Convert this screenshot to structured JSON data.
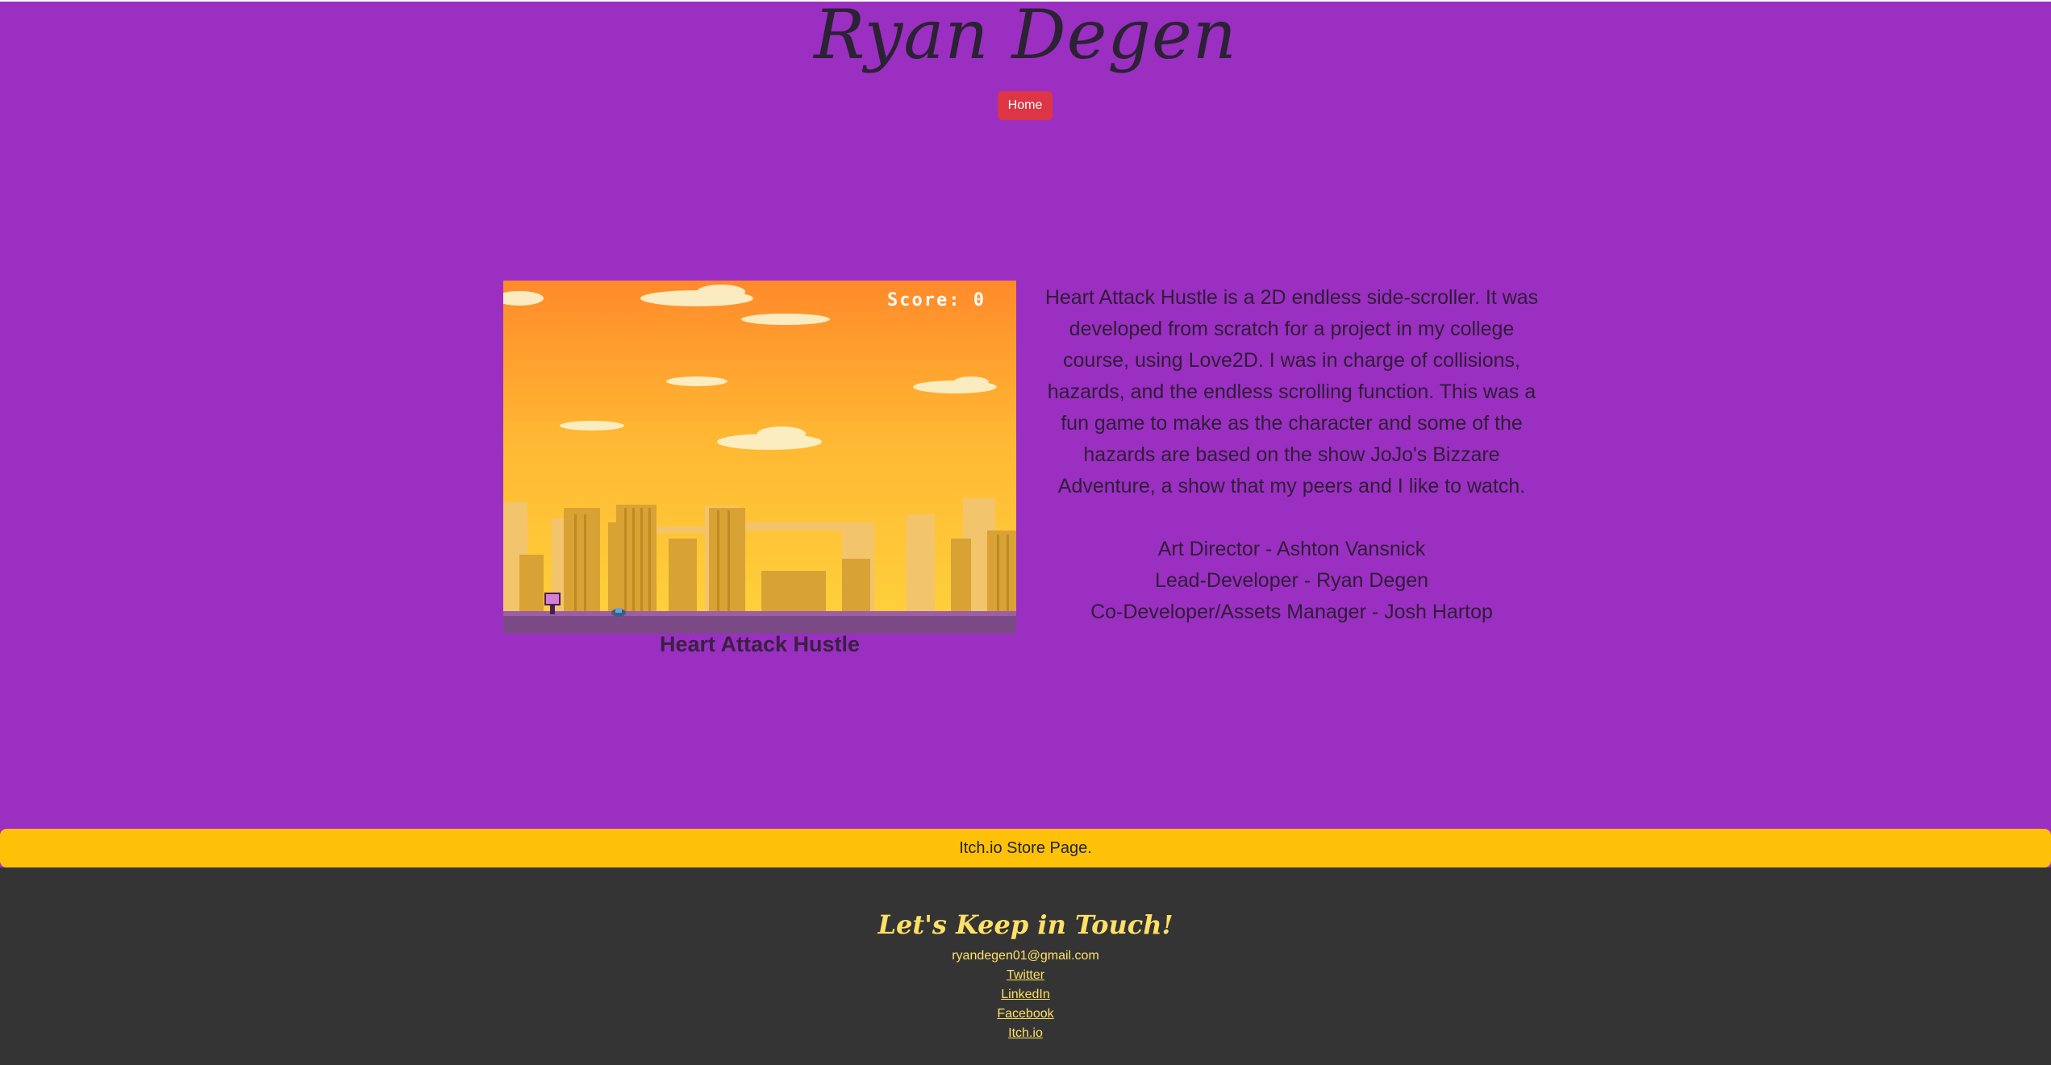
{
  "header": {
    "title": "Ryan Degen",
    "nav": {
      "home_label": "Home"
    }
  },
  "project": {
    "game_hud": {
      "score_label": "Score: 0"
    },
    "caption": "Heart Attack Hustle",
    "description": "Heart Attack Hustle is a 2D endless side-scroller. It was developed from scratch for a project in my college course, using Love2D. I was in charge of collisions, hazards, and the endless scrolling function. This was a fun game to make as the character and some of the hazards are based on the show JoJo's Bizzare Adventure, a show that my peers and I like to watch.",
    "credits": [
      "Art Director - Ashton Vansnick",
      "Lead-Developer - Ryan Degen",
      "Co-Developer/Assets Manager - Josh Hartop"
    ]
  },
  "store_bar": {
    "label": "Itch.io Store Page."
  },
  "footer": {
    "title": "Let's Keep in Touch!",
    "email": "ryandegen01@gmail.com",
    "links": {
      "twitter": "Twitter",
      "linkedin": "LinkedIn",
      "facebook": "Facebook",
      "itchio": "Itch.io"
    }
  },
  "colors": {
    "page_background": "#9a2fc2",
    "home_button": "#dc3545",
    "store_bar": "#ffc107",
    "footer_background": "#343434",
    "footer_text": "#ffe066"
  }
}
